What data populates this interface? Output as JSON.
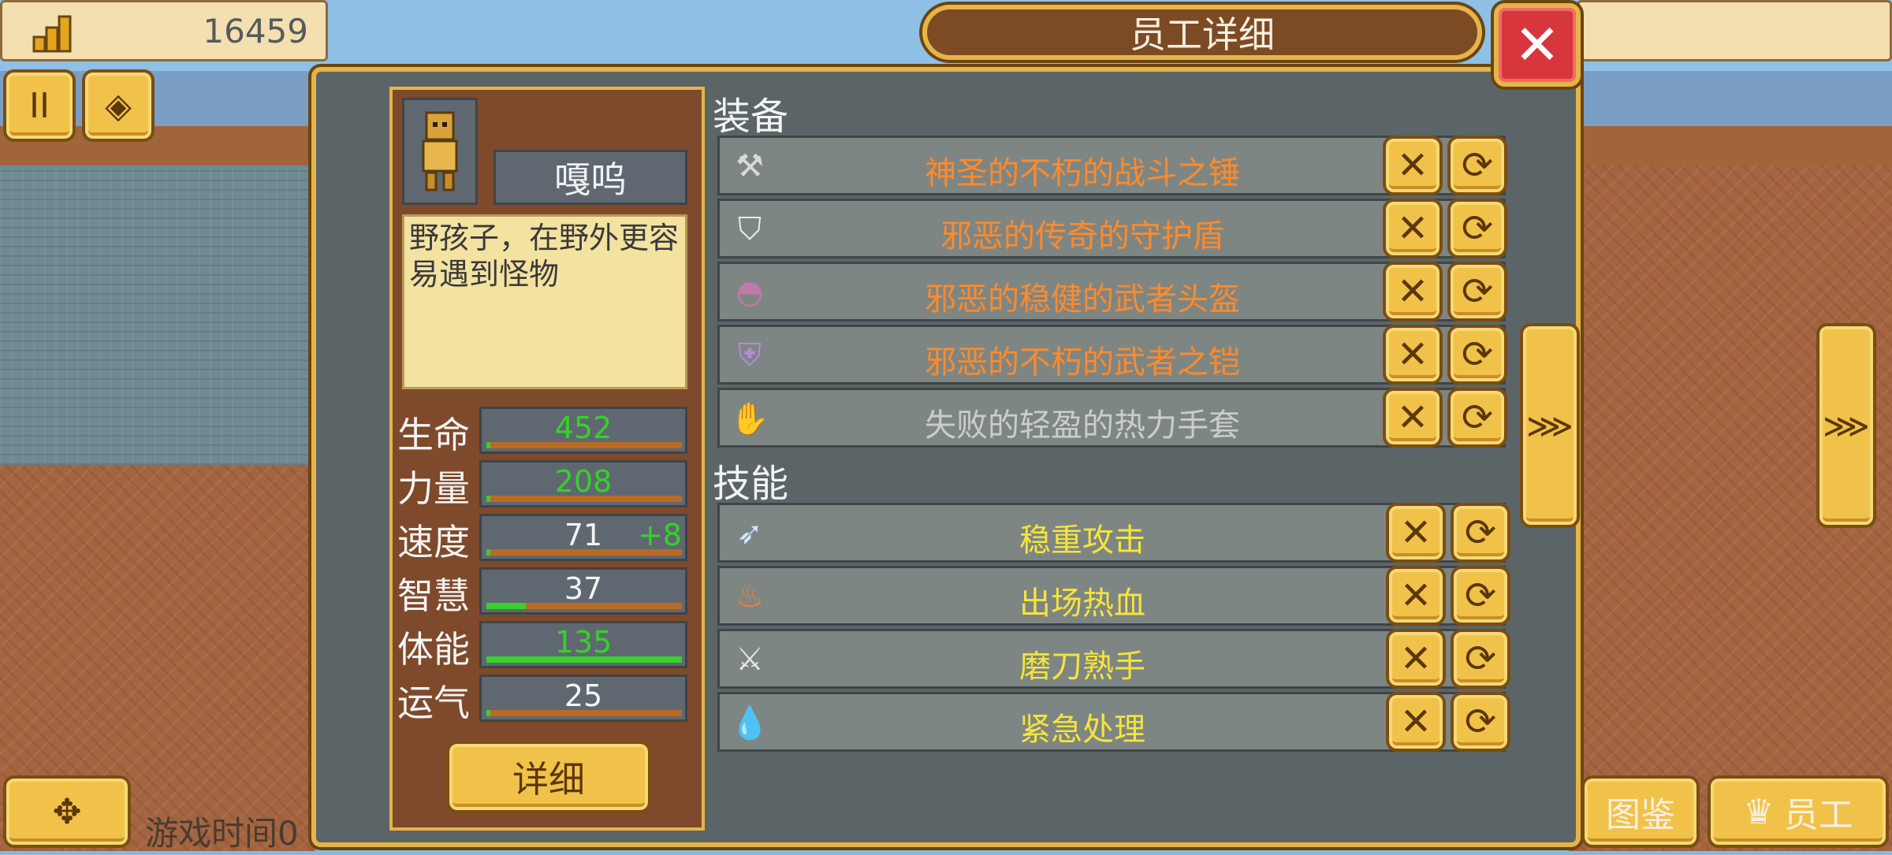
{
  "hud": {
    "coins": "16459",
    "coins_icon": "coin-stack-icon",
    "pause_label": "II",
    "game_time_label": "游戏时间0"
  },
  "panel": {
    "title": "员工详细",
    "close_label": "✕"
  },
  "employee": {
    "name": "嘎呜",
    "description": "野孩子，在野外更容易遇到怪物",
    "detail_button": "详细",
    "stats": [
      {
        "label": "生命",
        "value": "452",
        "bonus": "",
        "value_color": "#37d12b",
        "fill": 0.02
      },
      {
        "label": "力量",
        "value": "208",
        "bonus": "",
        "value_color": "#37d12b",
        "fill": 0.02
      },
      {
        "label": "速度",
        "value": "71",
        "bonus": "+8",
        "value_color": "#f3f3f3",
        "fill": 0.02
      },
      {
        "label": "智慧",
        "value": "37",
        "bonus": "",
        "value_color": "#f3f3f3",
        "fill": 0.2
      },
      {
        "label": "体能",
        "value": "135",
        "bonus": "",
        "value_color": "#37d12b",
        "fill": 1.0
      },
      {
        "label": "运气",
        "value": "25",
        "bonus": "",
        "value_color": "#f3f3f3",
        "fill": 0.02
      }
    ]
  },
  "equipment": {
    "heading": "装备",
    "items": [
      {
        "name": "神圣的不朽的战斗之锤",
        "color": "#ff8a2a",
        "icon": "hammer-icon",
        "glyph": "⚒"
      },
      {
        "name": "邪恶的传奇的守护盾",
        "color": "#ff8a2a",
        "icon": "shield-icon",
        "glyph": "⛉"
      },
      {
        "name": "邪恶的稳健的武者头盔",
        "color": "#ff8a2a",
        "icon": "helmet-icon",
        "glyph": "◓"
      },
      {
        "name": "邪恶的不朽的武者之铠",
        "color": "#ff8a2a",
        "icon": "armor-icon",
        "glyph": "⛨"
      },
      {
        "name": "失败的轻盈的热力手套",
        "color": "#c9cdcd",
        "icon": "glove-icon",
        "glyph": "✋"
      }
    ]
  },
  "skills": {
    "heading": "技能",
    "items": [
      {
        "name": "稳重攻击",
        "color": "#f6e43a",
        "icon": "slash-icon",
        "glyph": "➶"
      },
      {
        "name": "出场热血",
        "color": "#f6e43a",
        "icon": "flame-icon",
        "glyph": "♨"
      },
      {
        "name": "磨刀熟手",
        "color": "#f6e43a",
        "icon": "sword-icon",
        "glyph": "⚔"
      },
      {
        "name": "紧急处理",
        "color": "#f6e43a",
        "icon": "potion-icon",
        "glyph": "💧"
      }
    ]
  },
  "actions": {
    "remove_glyph": "✕",
    "swap_glyph": "⟳"
  },
  "nav": {
    "prev_glyph": "⋘",
    "next_glyph": "⋙"
  },
  "bottom": {
    "codex_label": "图鉴",
    "staff_label": "员工",
    "staff_icon": "crown-icon"
  }
}
